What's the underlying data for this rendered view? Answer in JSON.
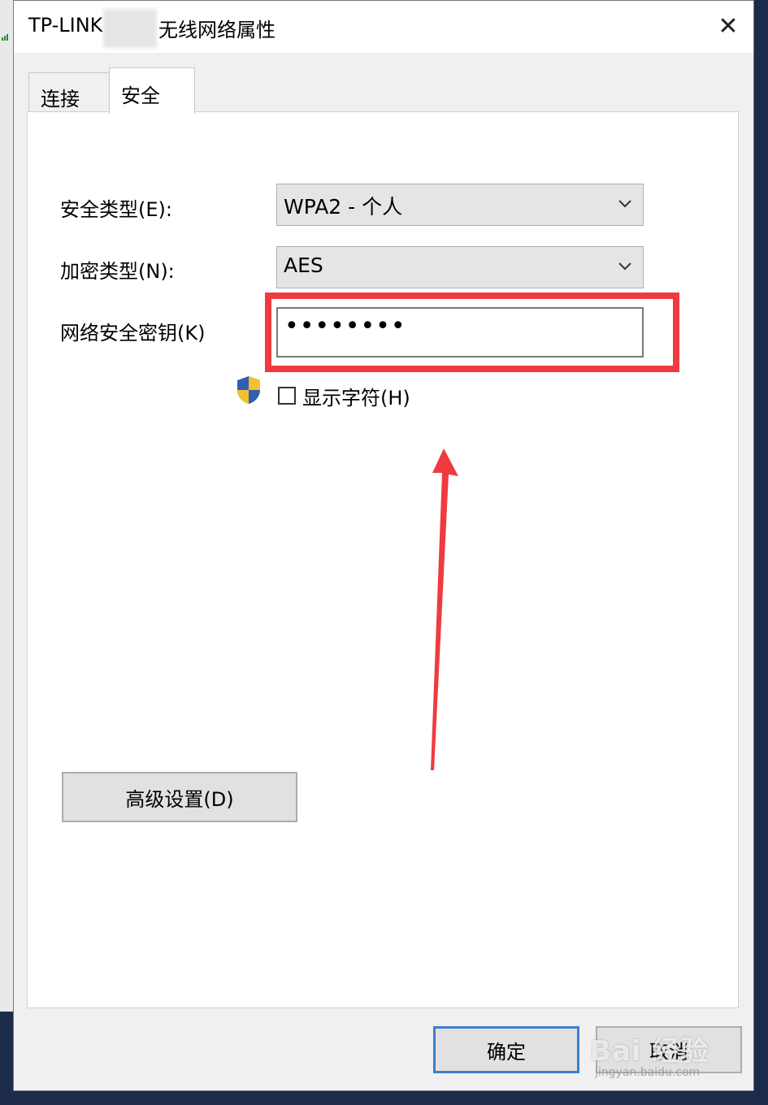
{
  "dialog": {
    "title_prefix": "TP-LINK",
    "title_suffix": "无线网络属性",
    "close_glyph": "✕"
  },
  "tabs": [
    {
      "label": "连接",
      "active": false
    },
    {
      "label": "安全",
      "active": true
    }
  ],
  "security": {
    "type_label": "安全类型(E):",
    "type_value": "WPA2 - 个人",
    "encryption_label": "加密类型(N):",
    "encryption_value": "AES",
    "key_label": "网络安全密钥(K)",
    "key_value": "••••••••",
    "show_chars_label": "显示字符(H)",
    "show_chars_checked": false
  },
  "buttons": {
    "advanced": "高级设置(D)",
    "ok": "确定",
    "cancel": "取消"
  },
  "watermark": {
    "main": "Bai 经验",
    "sub": "jingyan.baidu.com"
  },
  "colors": {
    "highlight": "#ef3b3f",
    "ok_border": "#3c7fd0"
  },
  "icons": {
    "close": "close-icon",
    "dropdown": "chevron-down-icon",
    "uac": "shield-icon",
    "annotation": "arrow-up-icon"
  }
}
